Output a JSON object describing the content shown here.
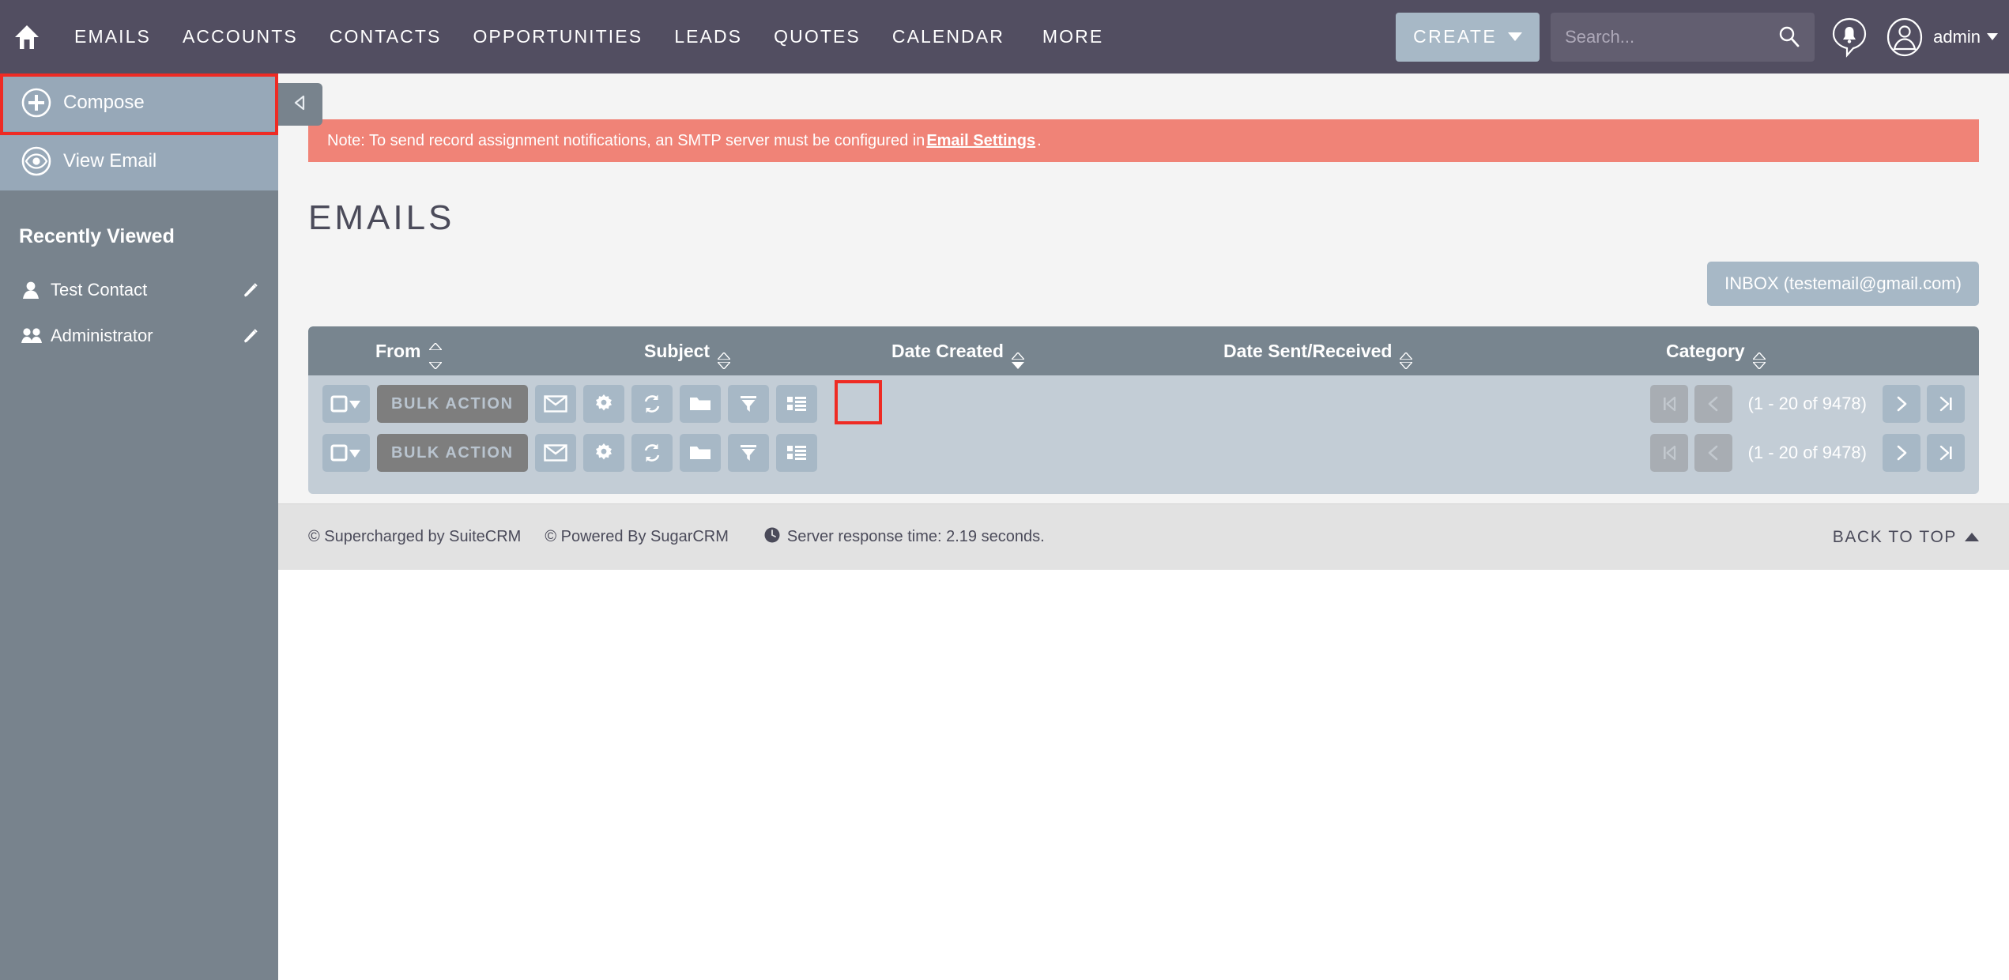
{
  "header": {
    "home_icon": "home-icon",
    "nav": [
      {
        "label": "EMAILS",
        "name": "nav-emails"
      },
      {
        "label": "ACCOUNTS",
        "name": "nav-accounts"
      },
      {
        "label": "CONTACTS",
        "name": "nav-contacts"
      },
      {
        "label": "OPPORTUNITIES",
        "name": "nav-opportunities"
      },
      {
        "label": "LEADS",
        "name": "nav-leads"
      },
      {
        "label": "QUOTES",
        "name": "nav-quotes"
      },
      {
        "label": "CALENDAR",
        "name": "nav-calendar"
      },
      {
        "label": "MORE",
        "name": "nav-more"
      }
    ],
    "create_label": "CREATE",
    "search_placeholder": "Search...",
    "search_value": "",
    "notifications_icon": "notification-bell-icon",
    "user_icon": "user-avatar-icon",
    "user_label": "admin",
    "colors": {
      "bar": "#524E61",
      "create_btn": "#A7B8C6",
      "search_field": "#625E70"
    }
  },
  "sidebar": {
    "actions": [
      {
        "label": "Compose",
        "icon": "plus-circle-icon",
        "name": "sidebar-compose",
        "highlighted": true
      },
      {
        "label": "View Email",
        "icon": "eye-icon",
        "name": "sidebar-view-email",
        "highlighted": false
      }
    ],
    "collapse_icon": "collapse-left-arrow-icon",
    "recently_viewed_title": "Recently Viewed",
    "recent_items": [
      {
        "label": "Test Contact",
        "icon": "contact-person-icon",
        "edit_icon": "pencil-edit-icon"
      },
      {
        "label": "Administrator",
        "icon": "users-group-icon",
        "edit_icon": "pencil-edit-icon"
      }
    ],
    "colors": {
      "body": "#78838D",
      "action": "#97A8B8",
      "highlight": "#EE2B24"
    }
  },
  "main": {
    "alert": {
      "text_before": "Note: To send record assignment notifications, an SMTP server must be configured in ",
      "link_text": "Email Settings",
      "text_after": ".",
      "color": "#F08377"
    },
    "page_title": "EMAILS",
    "inbox_button": "INBOX (testemail@gmail.com)",
    "columns": [
      {
        "label": "From",
        "sort": "none"
      },
      {
        "label": "Subject",
        "sort": "none"
      },
      {
        "label": "Date Created",
        "sort": "desc"
      },
      {
        "label": "Date Sent/Received",
        "sort": "none"
      },
      {
        "label": "Category",
        "sort": "none"
      }
    ],
    "toolbar": {
      "select_all_icon": "checkbox-dropdown-icon",
      "bulk_action_label": "BULK ACTION",
      "buttons": [
        {
          "icon": "envelope-icon",
          "name": "compose-email-button",
          "highlighted": true
        },
        {
          "icon": "gear-icon",
          "name": "settings-button",
          "highlighted": false
        },
        {
          "icon": "refresh-icon",
          "name": "refresh-button",
          "highlighted": false
        },
        {
          "icon": "folder-icon",
          "name": "folder-button",
          "highlighted": false
        },
        {
          "icon": "filter-icon",
          "name": "filter-button",
          "highlighted": false
        },
        {
          "icon": "list-view-icon",
          "name": "list-view-button",
          "highlighted": false
        }
      ]
    },
    "pagination": {
      "first_icon": "first-page-icon",
      "prev_icon": "previous-page-icon",
      "count_text": "(1 - 20 of 9478)",
      "next_icon": "next-page-icon",
      "last_icon": "last-page-icon",
      "first_enabled": false,
      "prev_enabled": false,
      "next_enabled": true,
      "last_enabled": true
    },
    "rows": []
  },
  "footer": {
    "suitecrm": "© Supercharged by SuiteCRM",
    "sugarcrm": "© Powered By SugarCRM",
    "response_time": "Server response time: 2.19 seconds.",
    "clock_icon": "clock-icon",
    "back_to_top": "BACK TO TOP"
  }
}
